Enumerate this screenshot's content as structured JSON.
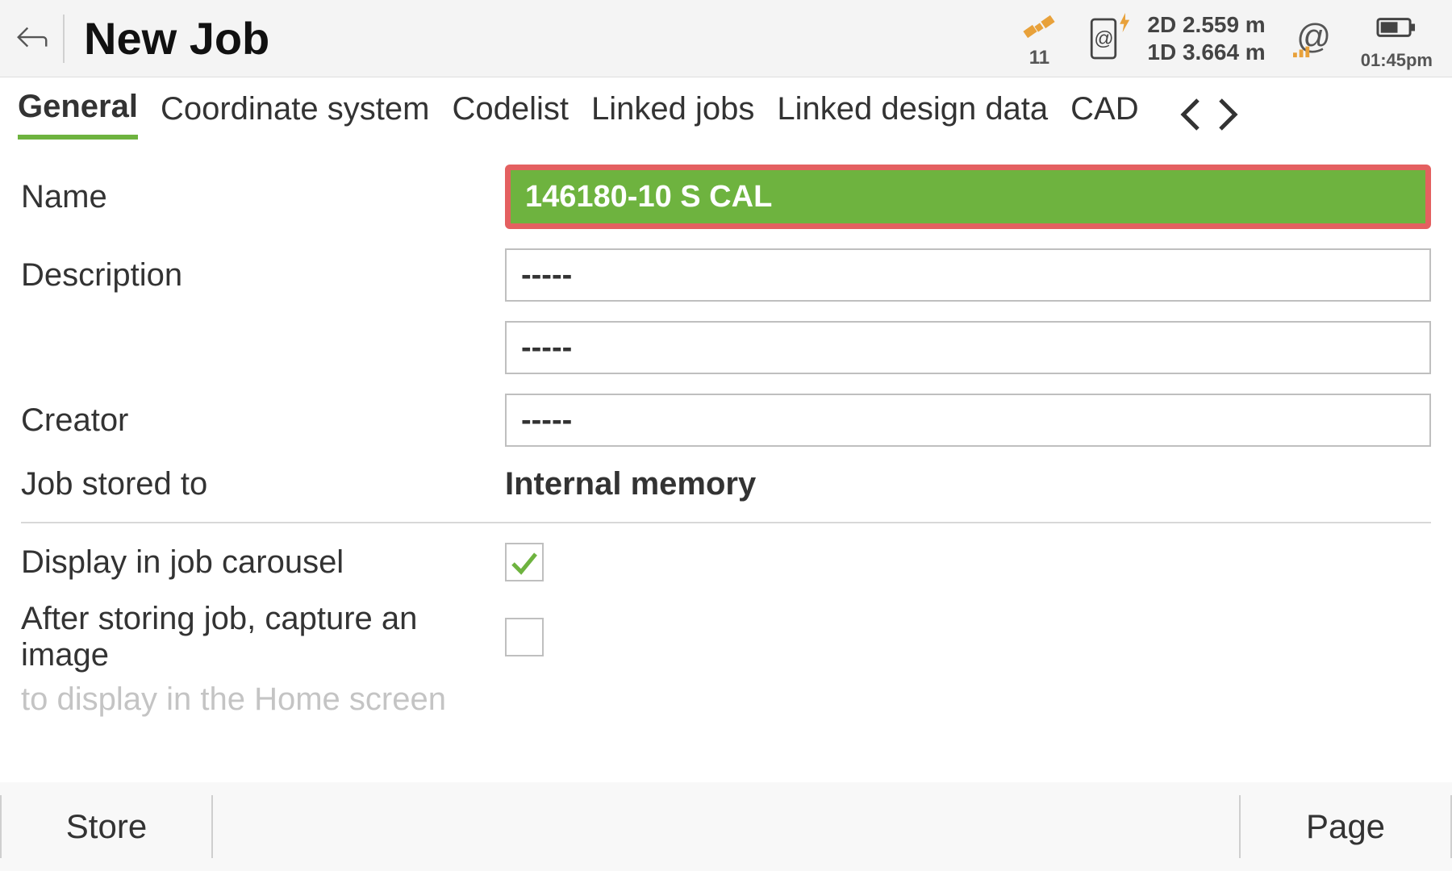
{
  "header": {
    "title": "New Job",
    "satellite_count": "11",
    "accuracy_2d": "2D 2.559 m",
    "accuracy_1d": "1D 3.664 m",
    "time": "01:45pm"
  },
  "tabs": {
    "items": [
      "General",
      "Coordinate system",
      "Codelist",
      "Linked jobs",
      "Linked design data",
      "CAD"
    ],
    "active_index": 0
  },
  "form": {
    "name_label": "Name",
    "name_value": "146180-10 S CAL",
    "description_label": "Description",
    "description_value_1": "-----",
    "description_value_2": "-----",
    "creator_label": "Creator",
    "creator_value": "-----",
    "stored_to_label": "Job stored to",
    "stored_to_value": "Internal memory",
    "carousel_label": "Display in job carousel",
    "carousel_checked": true,
    "capture_label": "After storing job, capture an image",
    "capture_checked": false,
    "cutoff_text": "to display in the Home screen"
  },
  "footer": {
    "store_label": "Store",
    "page_label": "Page"
  },
  "colors": {
    "accent": "#6eb33f",
    "highlight_border": "#e46060"
  }
}
